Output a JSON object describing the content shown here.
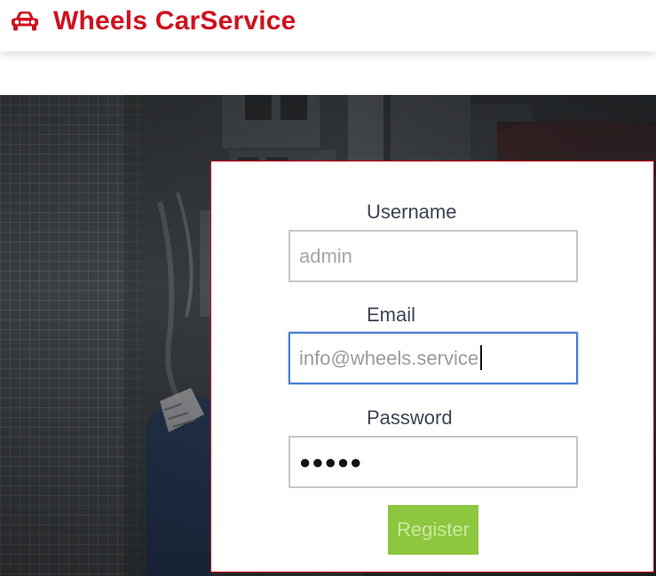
{
  "brand": {
    "name": "Wheels CarService",
    "icon": "car-icon",
    "color": "#d0101e"
  },
  "form": {
    "username": {
      "label": "Username",
      "placeholder": "admin",
      "value": ""
    },
    "email": {
      "label": "Email",
      "placeholder": "",
      "value": "info@wheels.service"
    },
    "password": {
      "label": "Password",
      "value": "●●●●●"
    },
    "register_label": "Register"
  },
  "colors": {
    "accent": "#d0101e",
    "button": "#8dc63f",
    "label": "#3c4353",
    "focus": "#4a7fd0"
  }
}
